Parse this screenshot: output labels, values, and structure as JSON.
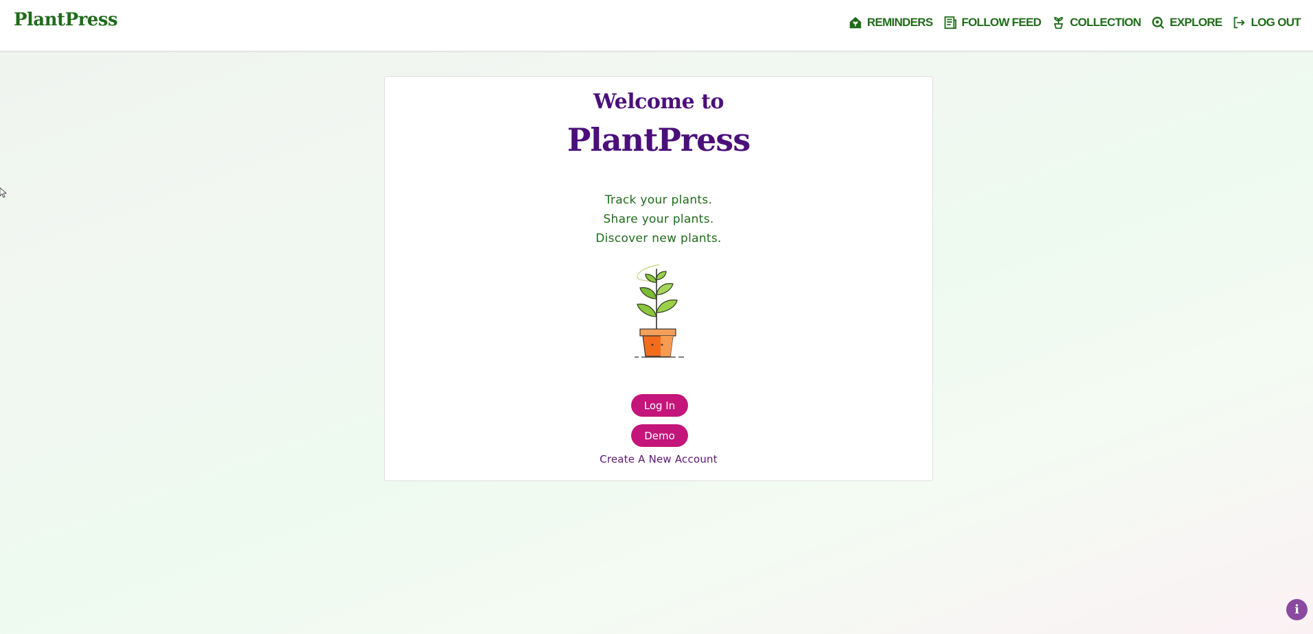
{
  "navbar": {
    "brand": "PlantPress",
    "links": [
      {
        "label": "REMINDERS",
        "icon": "home-plant-icon"
      },
      {
        "label": "FOLLOW FEED",
        "icon": "newspaper-icon"
      },
      {
        "label": "COLLECTION",
        "icon": "sprout-icon"
      },
      {
        "label": "EXPLORE",
        "icon": "search-icon"
      },
      {
        "label": "LOG OUT",
        "icon": "logout-icon"
      }
    ]
  },
  "card": {
    "welcome": "Welcome to",
    "title": "PlantPress",
    "taglines": [
      "Track your plants.",
      "Share your plants.",
      "Discover new plants."
    ],
    "illustration": "potted-plant-illustration",
    "login_label": "Log In",
    "demo_label": "Demo",
    "create_account_label": "Create A New Account"
  },
  "info_button": {
    "label": "i",
    "icon": "info-icon"
  },
  "colors": {
    "brand_green": "#1f6b1a",
    "title_purple": "#4b0f7a",
    "button_magenta": "#c4157a",
    "link_purple": "#5b1670",
    "info_purple": "#8a4a9f"
  }
}
